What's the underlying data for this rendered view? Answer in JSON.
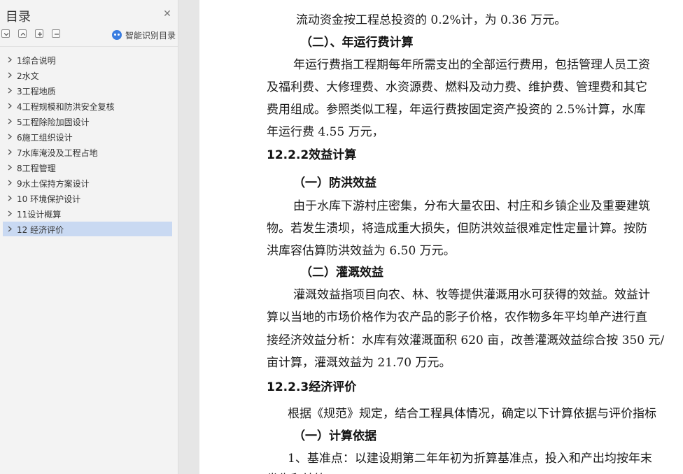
{
  "sidebar": {
    "title": "目录",
    "ai_label": "智能识别目录",
    "toc": [
      {
        "label": "1综合说明"
      },
      {
        "label": "2水文"
      },
      {
        "label": "3工程地质"
      },
      {
        "label": "4工程规模和防洪安全复核"
      },
      {
        "label": "5工程除险加固设计"
      },
      {
        "label": "6施工组织设计"
      },
      {
        "label": "7水库淹没及工程占地"
      },
      {
        "label": "8工程管理"
      },
      {
        "label": "9水土保持方案设计"
      },
      {
        "label": "10  环境保护设计"
      },
      {
        "label": "11设计概算"
      },
      {
        "label": "12  经济评价",
        "selected": true
      }
    ]
  },
  "document": {
    "lines": [
      "流动资金按工程总投资的 0.2%计，为 0.36 万元。",
      "（二）、年运行费计算",
      "年运行费指工程期每年所需支出的全部运行费用，包括管理人员工资",
      "及福利费、大修理费、水资源费、燃料及动力费、维护费、管理费和其它",
      "费用组成。参照类似工程，年运行费按固定资产投资的 2.5%计算，水库",
      "年运行费 4.55 万元，",
      "12.2.2效益计算",
      "（一）防洪效益",
      "由于水库下游村庄密集，分布大量农田、村庄和乡镇企业及重要建筑",
      "物。若发生溃坝，将造成重大损失，但防洪效益很难定性定量计算。按防",
      "洪库容估算防洪效益为 6.50 万元。",
      "（二）灌溉效益",
      "灌溉效益指项目向农、林、牧等提供灌溉用水可获得的效益。效益计",
      "算以当地的市场价格作为农产品的影子价格，农作物多年平均单产进行直",
      "接经济效益分析：水库有效灌溉面积 620 亩，改善灌溉效益综合按 350 元/",
      "亩计算，灌溉效益为 21.70 万元。",
      "12.2.3经济评价",
      "根据《规范》规定，结合工程具体情况，确定以下计算依据与评价指标",
      "（一）计算依据",
      "1、基准点：以建设期第二年年初为折算基准点，投入和产出均按年末",
      "发生和结算"
    ]
  }
}
